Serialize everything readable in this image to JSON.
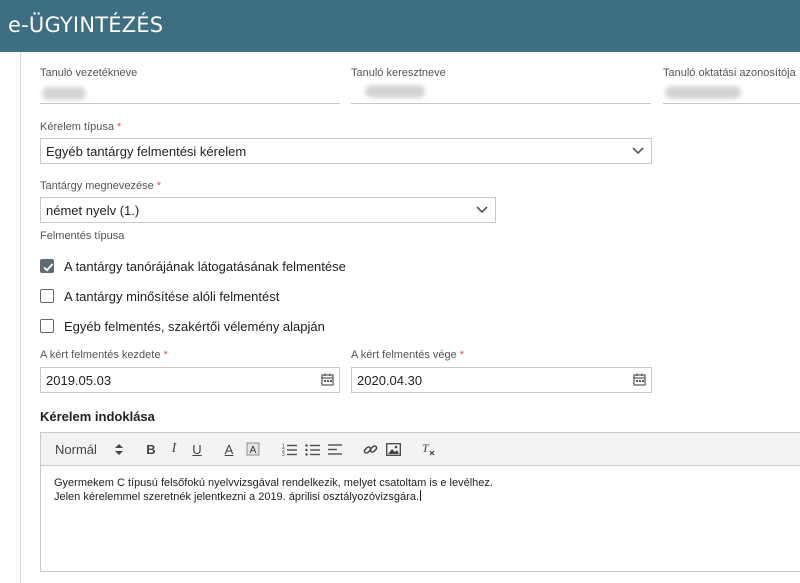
{
  "app": {
    "title": "e-ÜGYINTÉZÉS"
  },
  "student": {
    "last_name_label": "Tanuló vezetékneve",
    "first_name_label": "Tanuló keresztneve",
    "id_label": "Tanuló oktatási azonosítója"
  },
  "request_type": {
    "label": "Kérelem típusa",
    "required_mark": "*",
    "value": "Egyéb tantárgy felmentési kérelem"
  },
  "subject": {
    "label": "Tantárgy megnevezése",
    "required_mark": "*",
    "value": "német nyelv (1.)"
  },
  "exemption_type": {
    "label": "Felmentés típusa",
    "options": [
      {
        "label": "A tantárgy tanórájának látogatásának felmentése",
        "checked": true
      },
      {
        "label": "A tantárgy minősítése alóli felmentést",
        "checked": false
      },
      {
        "label": "Egyéb felmentés, szakértői vélemény alapján",
        "checked": false
      }
    ]
  },
  "dates": {
    "start_label": "A kért felmentés kezdete",
    "start_value": "2019.05.03",
    "end_label": "A kért felmentés vége",
    "end_value": "2020.04.30",
    "required_mark": "*"
  },
  "justification": {
    "title": "Kérelem indoklása",
    "toolbar": {
      "format_select": "Normál",
      "bold": "B",
      "italic": "I",
      "underline": "U",
      "font_color": "A"
    },
    "lines": [
      "Gyermekem C típusú felsőfokú nyelvvizsgával rendelkezik, melyet csatoltam is e levélhez.",
      "Jelen kérelemmel szeretnék jelentkezni a 2019. áprilisi osztályozóvizsgára."
    ]
  }
}
